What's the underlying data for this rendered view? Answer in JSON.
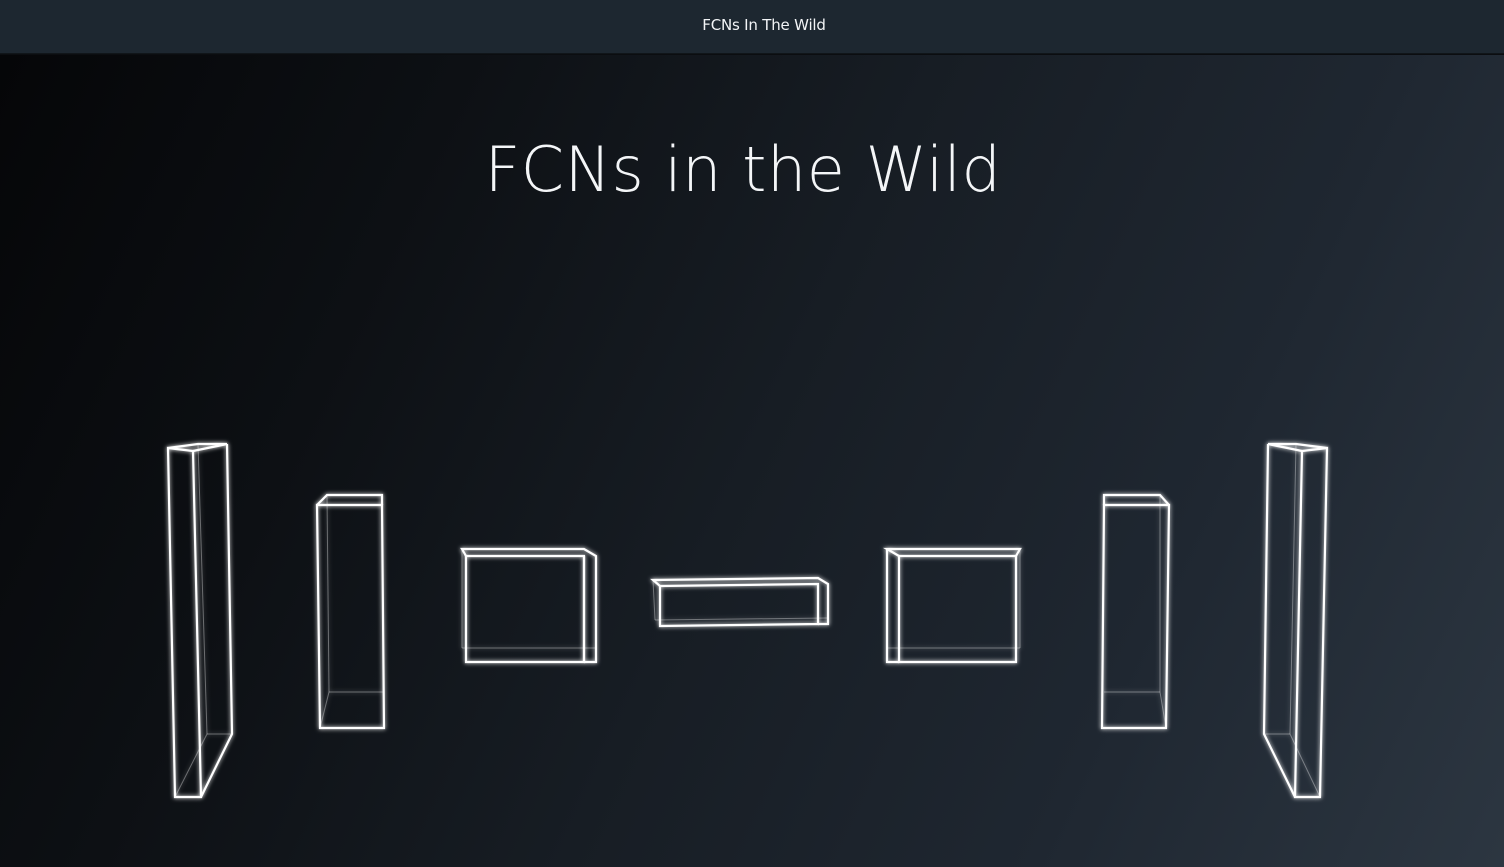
{
  "header": {
    "title": "FCNs In The Wild"
  },
  "hero": {
    "title": "FCNs in the Wild"
  },
  "theme": {
    "topbar_bg": "#1d2730",
    "text_color": "#ffffff",
    "box_stroke": "#ffffff"
  }
}
